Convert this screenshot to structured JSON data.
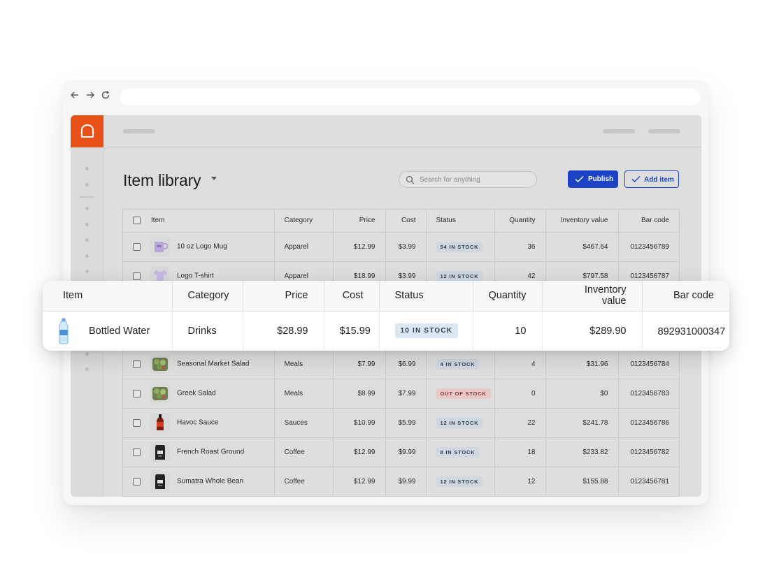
{
  "app": {
    "title": "Item library",
    "search": {
      "placeholder": "Search for anything"
    },
    "toolbar": {
      "publish_label": "Publish",
      "add_item_label": "Add item"
    },
    "brand_color": "#e8501a",
    "accent_color": "#1b43c4"
  },
  "table": {
    "columns": [
      "Item",
      "Category",
      "Price",
      "Cost",
      "Status",
      "Quantity",
      "Inventory value",
      "Bar code"
    ],
    "rows": [
      {
        "name": "10 oz Logo Mug",
        "category": "Apparel",
        "price": "$12.99",
        "cost": "$3.99",
        "status": "54 IN STOCK",
        "status_type": "in",
        "quantity": "36",
        "inventory_value": "$467.64",
        "bar_code": "0123456789",
        "icon": "mug-icon"
      },
      {
        "name": "Logo T-shirt",
        "category": "Apparel",
        "price": "$18.99",
        "cost": "$3.99",
        "status": "12 IN STOCK",
        "status_type": "in",
        "quantity": "42",
        "inventory_value": "$797.58",
        "bar_code": "0123456787",
        "icon": "tshirt-icon"
      },
      {
        "name": "Seasonal Market Salad",
        "category": "Meals",
        "price": "$7.99",
        "cost": "$6.99",
        "status": "4 IN STOCK",
        "status_type": "in",
        "quantity": "4",
        "inventory_value": "$31.96",
        "bar_code": "0123456784",
        "icon": "salad-icon"
      },
      {
        "name": "Greek Salad",
        "category": "Meals",
        "price": "$8.99",
        "cost": "$7.99",
        "status": "OUT OF STOCK",
        "status_type": "out",
        "quantity": "0",
        "inventory_value": "$0",
        "bar_code": "0123456783",
        "icon": "salad-icon"
      },
      {
        "name": "Havoc Sauce",
        "category": "Sauces",
        "price": "$10.99",
        "cost": "$5.99",
        "status": "12 IN STOCK",
        "status_type": "in",
        "quantity": "22",
        "inventory_value": "$241.78",
        "bar_code": "0123456786",
        "icon": "sauce-bottle-icon"
      },
      {
        "name": "French Roast Ground",
        "category": "Coffee",
        "price": "$12.99",
        "cost": "$9.99",
        "status": "8 IN STOCK",
        "status_type": "in",
        "quantity": "18",
        "inventory_value": "$233.82",
        "bar_code": "0123456782",
        "icon": "coffee-bag-icon"
      },
      {
        "name": "Sumatra Whole Bean",
        "category": "Coffee",
        "price": "$12.99",
        "cost": "$9.99",
        "status": "12 IN STOCK",
        "status_type": "in",
        "quantity": "12",
        "inventory_value": "$155.88",
        "bar_code": "0123456781",
        "icon": "coffee-bag-icon"
      }
    ]
  },
  "highlight": {
    "name": "Bottled Water",
    "category": "Drinks",
    "price": "$28.99",
    "cost": "$15.99",
    "status": "10 IN STOCK",
    "quantity": "10",
    "inventory_value": "$289.90",
    "bar_code": "892931000347",
    "icon": "water-bottle-icon"
  }
}
